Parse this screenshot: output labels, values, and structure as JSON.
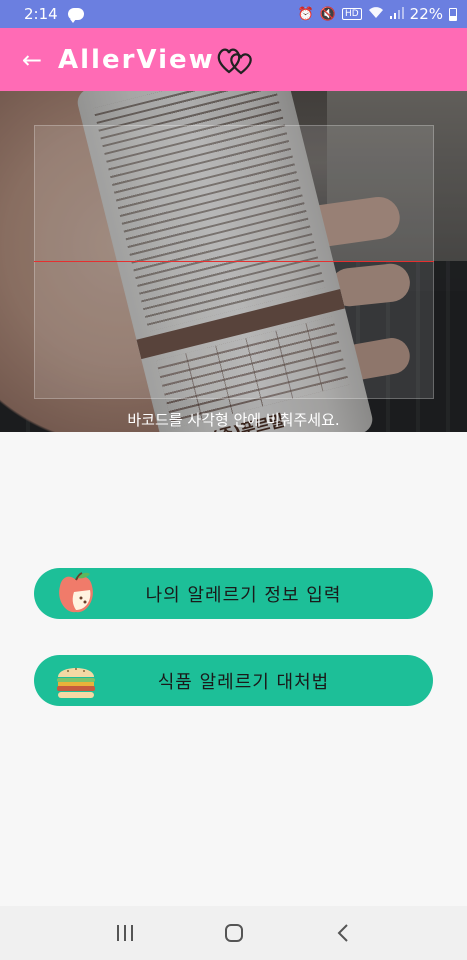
{
  "status_bar": {
    "time": "2:14",
    "battery_text": "22%",
    "icons": [
      "chat-icon",
      "alarm-icon",
      "mute-icon",
      "hd-icon",
      "wifi-icon",
      "signal-icon",
      "battery-icon"
    ],
    "hd_label": "HD"
  },
  "app_bar": {
    "title": "AllerView",
    "back_icon": "back-arrow-icon",
    "logo_icon": "hearts-icon",
    "background_color": "#ff6bb5"
  },
  "camera": {
    "hint": "바코드를 사각형 안에 비춰주세요.",
    "bottle_brand": "(주)푸르밀"
  },
  "buttons": [
    {
      "label": "나의 알레르기 정보 입력",
      "icon": "apple-icon"
    },
    {
      "label": "식품 알레르기 대처법",
      "icon": "burger-icon"
    }
  ],
  "colors": {
    "status_bar": "#6b7fe0",
    "accent": "#1dbf98",
    "scan_line": "#e53030"
  },
  "nav_bar": {
    "items": [
      "recent-apps-icon",
      "home-icon",
      "back-icon"
    ]
  }
}
